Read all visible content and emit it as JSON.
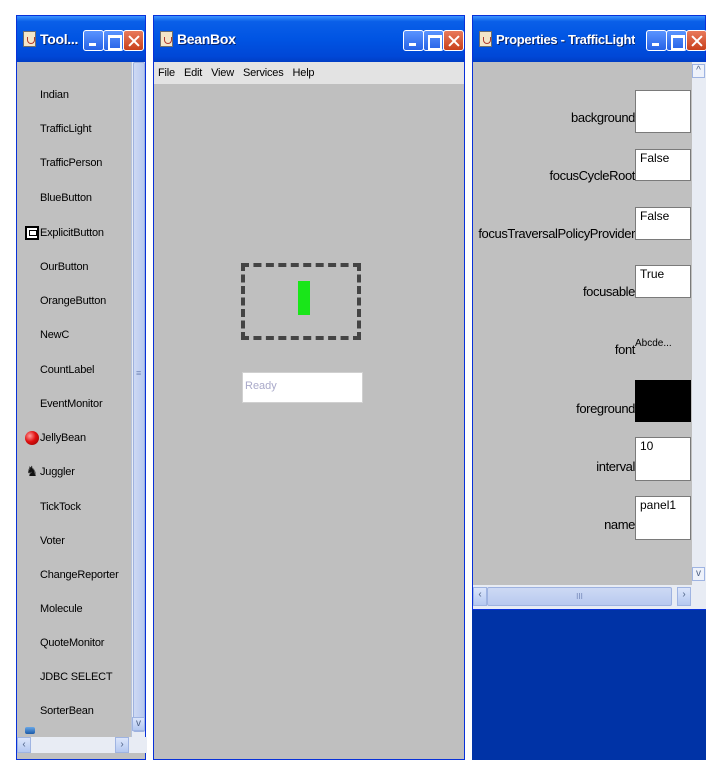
{
  "toolbox": {
    "title": "Tool...",
    "items": [
      "Indian",
      "TrafficLight",
      "TrafficPerson",
      "BlueButton",
      "ExplicitButton",
      "OurButton",
      "OrangeButton",
      "NewC",
      "CountLabel",
      "EventMonitor",
      "JellyBean",
      "Juggler",
      "TickTock",
      "Voter",
      "ChangeReporter",
      "Molecule",
      "QuoteMonitor",
      "JDBC SELECT",
      "SorterBean"
    ]
  },
  "beanbox": {
    "title": "BeanBox",
    "menu": [
      "File",
      "Edit",
      "View",
      "Services",
      "Help"
    ],
    "status_text": "Ready"
  },
  "properties": {
    "title": "Properties - TrafficLight",
    "labels": {
      "background": "background",
      "focusCycleRoot": "focusCycleRoot",
      "focusTraversalPolicyProvider": "focusTraversalPolicyProvider",
      "focusable": "focusable",
      "font": "font",
      "foreground": "foreground",
      "interval": "interval",
      "name": "name"
    },
    "values": {
      "focusCycleRoot": "False",
      "focusTraversalPolicyProvider": "False",
      "focusable": "True",
      "font": "Abcde...",
      "interval": "10",
      "name": "panel1"
    },
    "colors": {
      "background": "#c0c0c0",
      "foreground": "#000000"
    }
  },
  "colors": {
    "titlebar": "#0054e3",
    "traffic_light": "#19e619",
    "desktop": "#0033a6"
  }
}
